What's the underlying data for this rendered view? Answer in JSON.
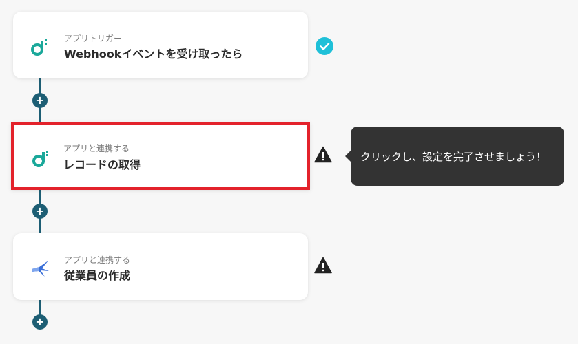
{
  "flow": {
    "steps": [
      {
        "sublabel": "アプリトリガー",
        "title": "Webhookイベントを受け取ったら",
        "app_icon": "app-logo-icon",
        "status": "completed"
      },
      {
        "sublabel": "アプリと連携する",
        "title": "レコードの取得",
        "app_icon": "app-logo-icon",
        "status": "warning"
      },
      {
        "sublabel": "アプリと連携する",
        "title": "従業員の作成",
        "app_icon": "bird-app-icon",
        "status": "warning"
      }
    ],
    "add_button_label": "+"
  },
  "tooltip": {
    "text": "クリックし、設定を完了させましょう！"
  },
  "colors": {
    "connector": "#1d5e74",
    "selected_border": "#e3222b",
    "check_badge": "#1fc0d8",
    "logo_teal": "#1aa89a",
    "tooltip_bg": "#333333"
  }
}
